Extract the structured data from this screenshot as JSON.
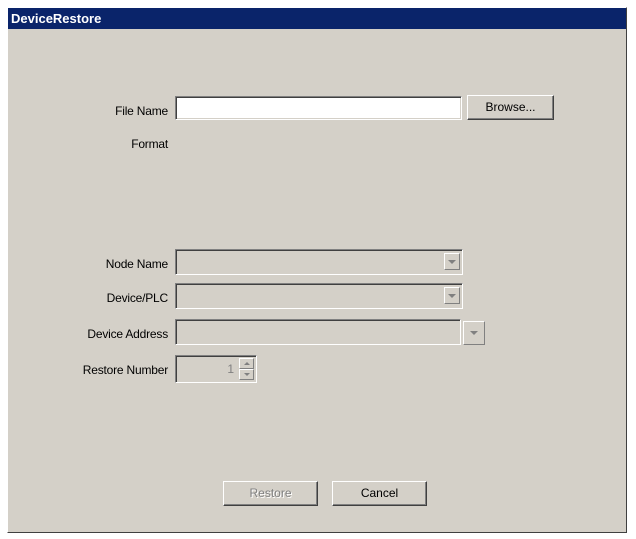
{
  "window": {
    "title": "DeviceRestore"
  },
  "file": {
    "label": "File Name",
    "value": "",
    "browse_label": "Browse..."
  },
  "format": {
    "label": "Format"
  },
  "node": {
    "label": "Node Name",
    "value": ""
  },
  "device": {
    "label": "Device/PLC",
    "value": ""
  },
  "address": {
    "label": "Device Address",
    "value": ""
  },
  "restore_number": {
    "label": "Restore Number",
    "value": "1"
  },
  "buttons": {
    "restore_label": "Restore",
    "cancel_label": "Cancel"
  },
  "colors": {
    "titlebar": "#0a246a",
    "dialog_bg": "#d4d0c8",
    "disabled_text": "#808080"
  }
}
